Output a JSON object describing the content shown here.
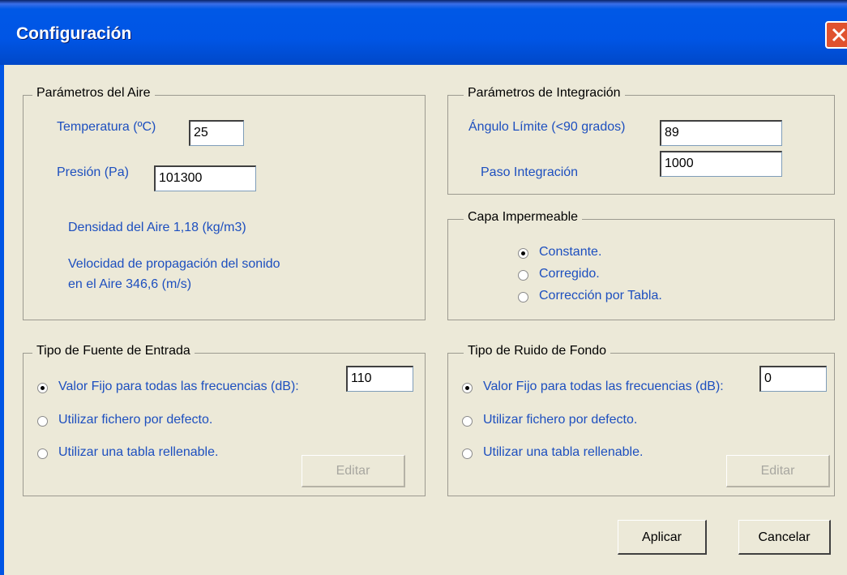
{
  "window": {
    "title": "Configuración"
  },
  "air": {
    "group_label": "Parámetros del Aire",
    "temperature_label": "Temperatura (ºC)",
    "temperature_value": "25",
    "pressure_label": "Presión (Pa)",
    "pressure_value": "101300",
    "density_text": "Densidad del Aire 1,18 (kg/m3)",
    "speed_line1": "Velocidad de propagación del sonido",
    "speed_line2": "en el Aire 346,6 (m/s)"
  },
  "integration": {
    "group_label": "Parámetros de Integración",
    "angle_label": "Ángulo Límite (<90 grados)",
    "angle_value": "89",
    "step_label": "Paso Integración",
    "step_value": "1000"
  },
  "layer": {
    "group_label": "Capa Impermeable",
    "options": [
      "Constante.",
      "Corregido.",
      "Corrección por Tabla."
    ],
    "selected": 0
  },
  "source": {
    "group_label": "Tipo de Fuente de Entrada",
    "options": [
      "Valor Fijo para todas las frecuencias (dB):",
      "Utilizar fichero por defecto.",
      "Utilizar una tabla rellenable."
    ],
    "selected": 0,
    "fixed_value": "110",
    "edit_label": "Editar"
  },
  "noise": {
    "group_label": "Tipo de Ruido de Fondo",
    "options": [
      "Valor Fijo para todas las frecuencias (dB):",
      "Utilizar fichero por defecto.",
      "Utilizar una tabla rellenable."
    ],
    "selected": 0,
    "fixed_value": "0",
    "edit_label": "Editar"
  },
  "buttons": {
    "apply": "Aplicar",
    "cancel": "Cancelar"
  },
  "colors": {
    "titlebar": "#0055E5",
    "label_blue": "#1D4FBF",
    "dialog_bg": "#ECE9D8",
    "close_red": "#E0522E"
  },
  "icons": {
    "close": "close-icon",
    "radio": "radio-button-icon"
  }
}
